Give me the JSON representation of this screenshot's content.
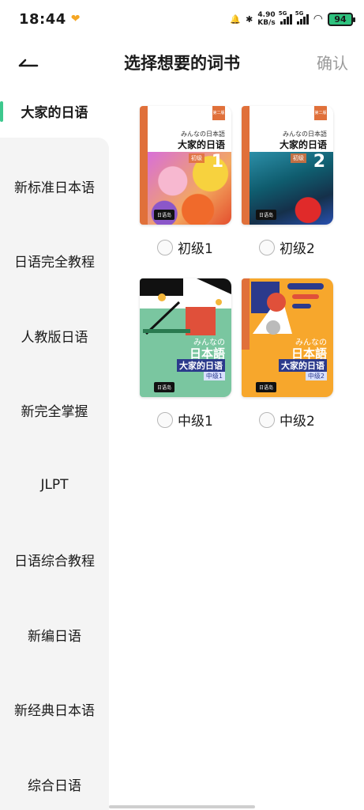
{
  "status_bar": {
    "time": "18:44",
    "net_speed_value": "4.90",
    "net_speed_unit": "KB/s",
    "signal_1_label": "5G",
    "signal_2_label": "5G",
    "battery": "94",
    "battery_color": "#2ec27e"
  },
  "header": {
    "back_icon": "back-arrow-icon",
    "title": "选择想要的词书",
    "confirm_label": "确认"
  },
  "sidebar": {
    "accent_color": "#3dc88e",
    "items": [
      {
        "label": "大家的日语",
        "active": true
      },
      {
        "label": "新标准日本语",
        "active": false
      },
      {
        "label": "日语完全教程",
        "active": false
      },
      {
        "label": "人教版日语",
        "active": false
      },
      {
        "label": "新完全掌握",
        "active": false
      },
      {
        "label": "JLPT",
        "active": false
      },
      {
        "label": "日语综合教程",
        "active": false
      },
      {
        "label": "新编日语",
        "active": false
      },
      {
        "label": "新经典日本语",
        "active": false
      },
      {
        "label": "综合日语",
        "active": false
      }
    ]
  },
  "books": [
    {
      "option_label": "初级1",
      "cover": {
        "edition": "第二版",
        "kana": "みんなの日本語",
        "title": "大家的日语",
        "level": "初级",
        "number": "1",
        "publisher": "日语岛"
      }
    },
    {
      "option_label": "初级2",
      "cover": {
        "edition": "第二版",
        "kana": "みんなの日本語",
        "title": "大家的日语",
        "level": "初级",
        "number": "2",
        "publisher": "日语岛"
      }
    },
    {
      "option_label": "中级1",
      "cover": {
        "kana": "みんなの",
        "title": "日本語",
        "cn_title": "大家的日语",
        "level": "中级1",
        "publisher": "日语岛"
      }
    },
    {
      "option_label": "中级2",
      "cover": {
        "kana": "みんなの",
        "title": "日本語",
        "cn_title": "大家的日语",
        "level": "中级2",
        "publisher": "日语岛"
      }
    }
  ]
}
